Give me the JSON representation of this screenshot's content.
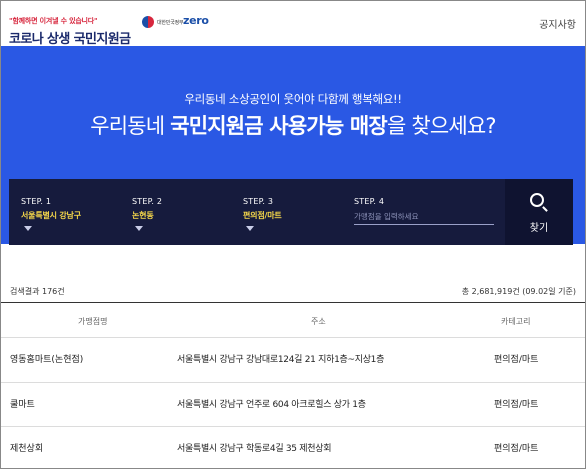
{
  "header": {
    "slogan": "\"함께하면 이겨낼 수 있습니다\"",
    "title": "코로나 상생 국민지원금",
    "gov_label": "대한민국정부",
    "partner": "zero",
    "notice_link": "공지사항"
  },
  "hero": {
    "subtitle": "우리동네 소상공인이 웃어야 다함께 행복해요!!",
    "headline_pre": "우리동네 ",
    "headline_bold": "국민지원금 사용가능 매장",
    "headline_post": "을 찾으세요?"
  },
  "steps": [
    {
      "label": "STEP. 1",
      "value": "서울특별시 강남구"
    },
    {
      "label": "STEP. 2",
      "value": "논현동"
    },
    {
      "label": "STEP. 3",
      "value": "편의점/마트"
    },
    {
      "label": "STEP. 4",
      "placeholder": "가맹점을 입력하세요"
    }
  ],
  "search_button": {
    "label": "찾기",
    "icon": "search-icon"
  },
  "results": {
    "count_text": "검색결과 176건",
    "total_text": "총 2,681,919건 (09.02일 기준)",
    "columns": [
      "가맹점명",
      "주소",
      "카테고리"
    ],
    "rows": [
      {
        "name": "영동홈마트(논현점)",
        "address": "서울특별시 강남구 강남대로124길 21 지하1층~지상1층",
        "category": "편의점/마트"
      },
      {
        "name": "쿨마트",
        "address": "서울특별시 강남구 언주로 604 아크로힐스 상가 1층",
        "category": "편의점/마트"
      },
      {
        "name": "제천상회",
        "address": "서울특별시 강남구 학동로4길 35 제천상회",
        "category": "편의점/마트"
      }
    ]
  },
  "colors": {
    "hero_blue": "#2a58e4",
    "step_bar": "#161b3d",
    "step_value": "#f5d74a",
    "brand_navy": "#1b2a6b"
  }
}
